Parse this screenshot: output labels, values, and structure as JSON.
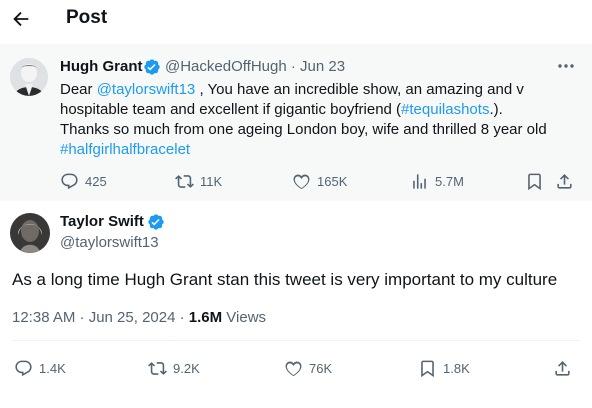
{
  "header": {
    "title": "Post",
    "back_icon": "arrow-left-icon"
  },
  "quoted_post": {
    "author_name": "Hugh Grant",
    "handle_and_date": "@HackedOffHugh · Jun 23",
    "text_line1_prefix": "Dear ",
    "mention": "@taylorswift13",
    "text_line1_suffix": " , You have an incredible show, an amazing and v",
    "text_line2_prefix": "hospitable team and excellent if gigantic boyfriend (",
    "hashtag_tequila": "#tequilashots",
    "text_line2_suffix": ".).",
    "text_line3": "Thanks so much from one ageing London boy, wife and thrilled 8 year old",
    "hashtag_bracelet": "#halfgirlhalfbracelet",
    "actions": {
      "replies": "425",
      "reposts": "11K",
      "likes": "165K",
      "views": "5.7M"
    }
  },
  "post": {
    "author_name": "Taylor Swift",
    "handle": "@taylorswift13",
    "text": "As a long time Hugh Grant stan this tweet is very important to my culture",
    "timestamp": "12:38 AM · Jun 25, 2024 · ",
    "views_count": "1.6M",
    "views_label": " Views",
    "actions": {
      "replies": "1.4K",
      "reposts": "9.2K",
      "likes": "76K",
      "bookmarks": "1.8K"
    }
  },
  "colors": {
    "link": "#1d9bf0",
    "muted": "#536471",
    "verified": "#1d9bf0",
    "quote_bg": "#f7f9f9"
  }
}
